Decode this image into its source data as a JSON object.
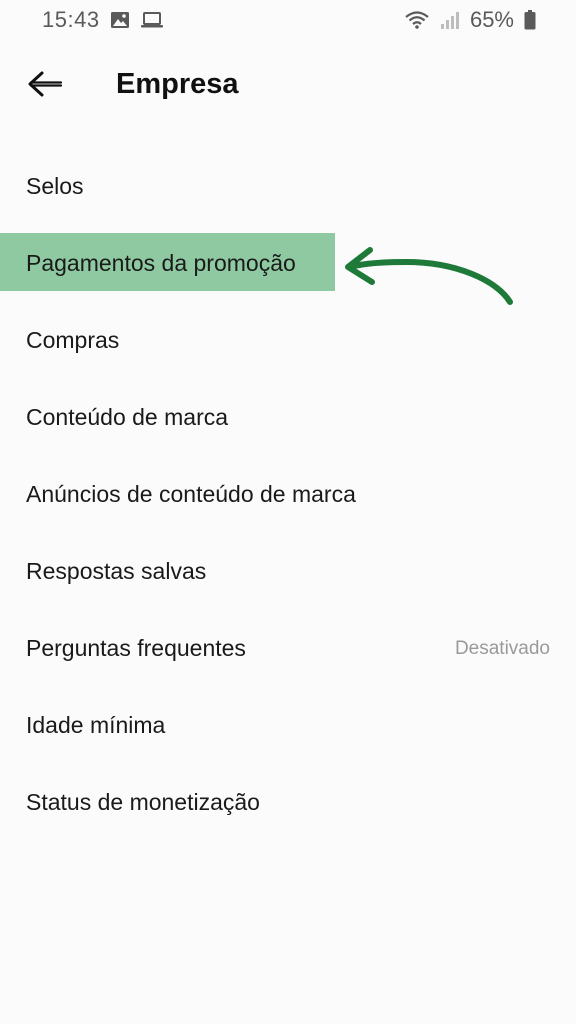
{
  "status_bar": {
    "time": "15:43",
    "battery": "65%",
    "icons": [
      "image-icon",
      "laptop-icon",
      "wifi-icon",
      "signal-icon",
      "battery-icon"
    ]
  },
  "header": {
    "back_icon": "back-arrow-icon",
    "title": "Empresa"
  },
  "menu": {
    "items": [
      {
        "label": "Selos",
        "value": ""
      },
      {
        "label": "Pagamentos da promoção",
        "value": "",
        "highlighted": true
      },
      {
        "label": "Compras",
        "value": ""
      },
      {
        "label": "Conteúdo de marca",
        "value": ""
      },
      {
        "label": "Anúncios de conteúdo de marca",
        "value": ""
      },
      {
        "label": "Respostas salvas",
        "value": ""
      },
      {
        "label": "Perguntas frequentes",
        "value": "Desativado"
      },
      {
        "label": "Idade mínima",
        "value": ""
      },
      {
        "label": "Status de monetização",
        "value": ""
      }
    ]
  },
  "colors": {
    "highlight": "#8fc9a1",
    "arrow": "#1f7a3a",
    "background": "#fbfbfb"
  }
}
